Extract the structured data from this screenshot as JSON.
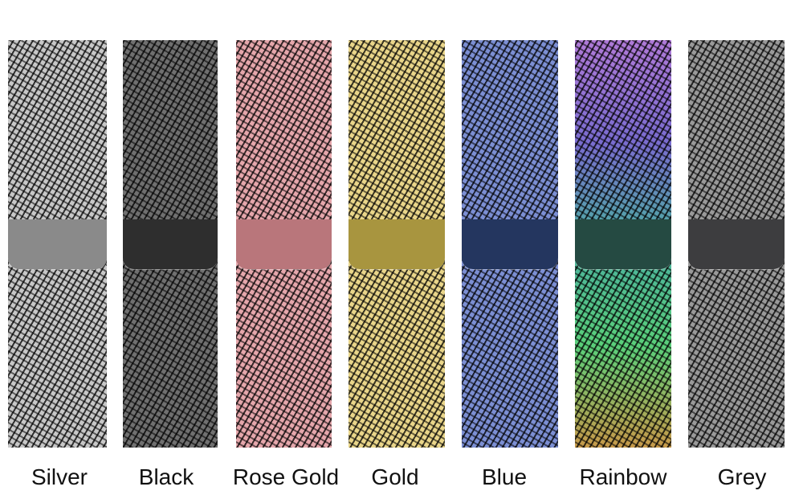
{
  "bands": [
    {
      "label": "Silver",
      "mesh": "#c8c8c8",
      "clasp": "#8a8a8a"
    },
    {
      "label": "Black",
      "mesh": "#707070",
      "clasp": "#2e2e2e"
    },
    {
      "label": "Rose Gold",
      "mesh": "#e6a7ac",
      "clasp": "#b9767b"
    },
    {
      "label": "Gold",
      "mesh": "#ead68a",
      "clasp": "#a8953f"
    },
    {
      "label": "Blue",
      "mesh": "#7c8fd4",
      "clasp": "#24365f"
    },
    {
      "label": "Rainbow",
      "mesh": "linear-gradient(180deg,#b07ad8 0%,#7a6cd0 25%,#4ab0a0 50%,#5ad07a 75%,#c89a4a 100%)",
      "clasp": "#254a42"
    },
    {
      "label": "Grey",
      "mesh": "#9a9a9a",
      "clasp": "#3d3d3f"
    }
  ]
}
